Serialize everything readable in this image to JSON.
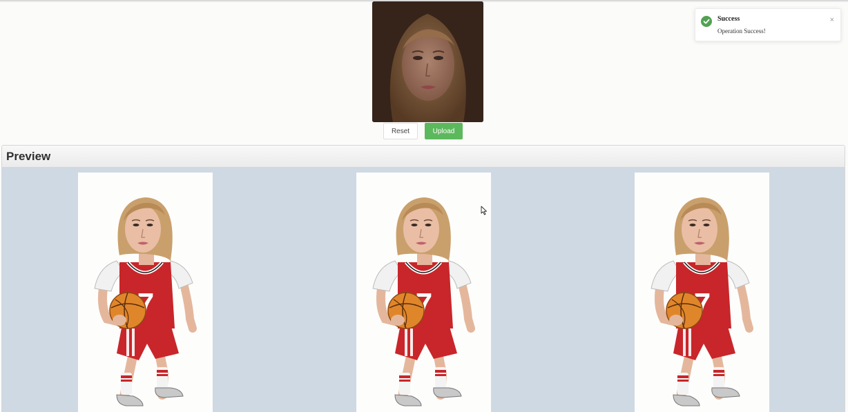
{
  "notification": {
    "title": "Success",
    "message": "Operation Success!",
    "close_glyph": "×",
    "icon": "check-circle-icon",
    "color": "#52a152"
  },
  "uploader": {
    "photo": "uploaded-face-photo",
    "reset_label": "Reset",
    "upload_label": "Upload",
    "upload_color": "#5cb85c"
  },
  "preview": {
    "title": "Preview",
    "background": "#cfd9e4",
    "cards": [
      {
        "image": "basketball-player-caricature",
        "jersey_number": "7"
      },
      {
        "image": "basketball-player-caricature",
        "jersey_number": "7"
      },
      {
        "image": "basketball-player-caricature",
        "jersey_number": "7"
      }
    ]
  }
}
